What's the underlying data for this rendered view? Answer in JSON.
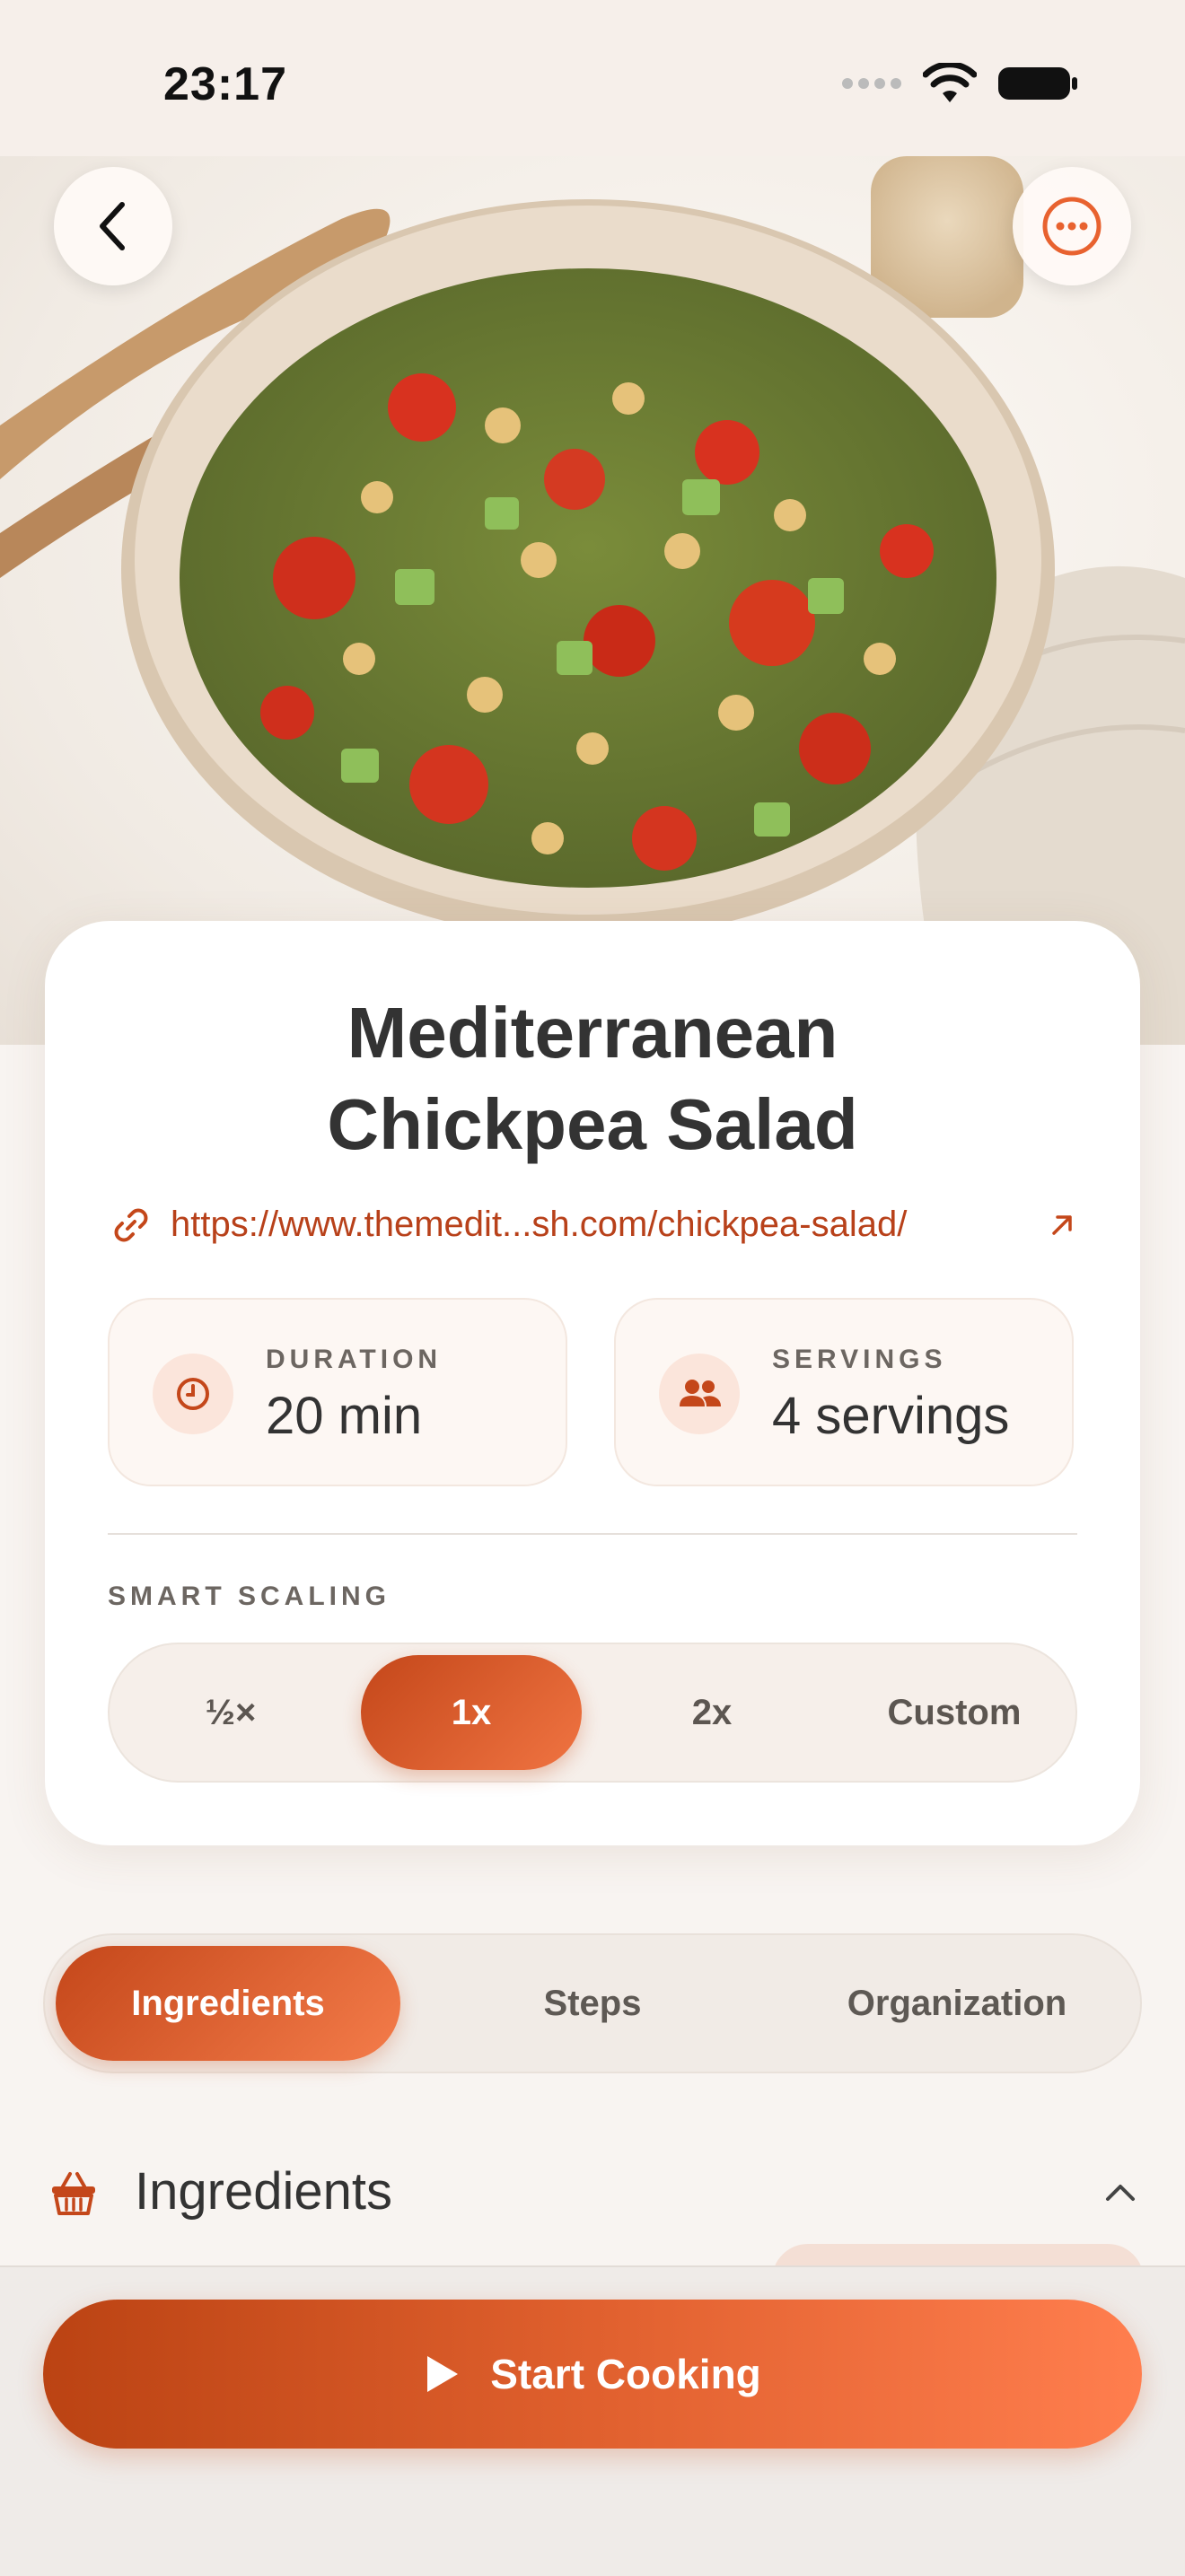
{
  "status_bar": {
    "time": "23:17"
  },
  "hero": {
    "image_alt": "Bowl of chickpea salad with tomatoes, cucumber and herbs"
  },
  "recipe": {
    "title_line1": "Mediterranean",
    "title_line2": "Chickpea Salad",
    "url": "https://www.themedit...sh.com/chickpea-salad/"
  },
  "stats": {
    "duration": {
      "label": "DURATION",
      "value": "20 min"
    },
    "servings": {
      "label": "SERVINGS",
      "value": "4 servings"
    }
  },
  "scaling": {
    "label": "SMART SCALING",
    "options": [
      "½×",
      "1x",
      "2x",
      "Custom"
    ],
    "selected": "1x"
  },
  "tabs": {
    "items": [
      "Ingredients",
      "Steps",
      "Organization"
    ],
    "selected": "Ingredients"
  },
  "ingredients_section": {
    "title": "Ingredients"
  },
  "primary_action": {
    "label": "Start Cooking"
  },
  "colors": {
    "accent": "#d8552a",
    "accent_dark": "#bb4313",
    "accent_light": "#ff7e4e",
    "background": "#f8f4f1"
  },
  "icons": {
    "back": "chevron-left-icon",
    "more": "more-horizontal-icon",
    "link": "link-icon",
    "external": "arrow-up-right-icon",
    "duration": "clock-icon",
    "servings": "people-icon",
    "ingredients": "basket-icon",
    "collapse": "chevron-up-icon",
    "play": "play-icon"
  }
}
